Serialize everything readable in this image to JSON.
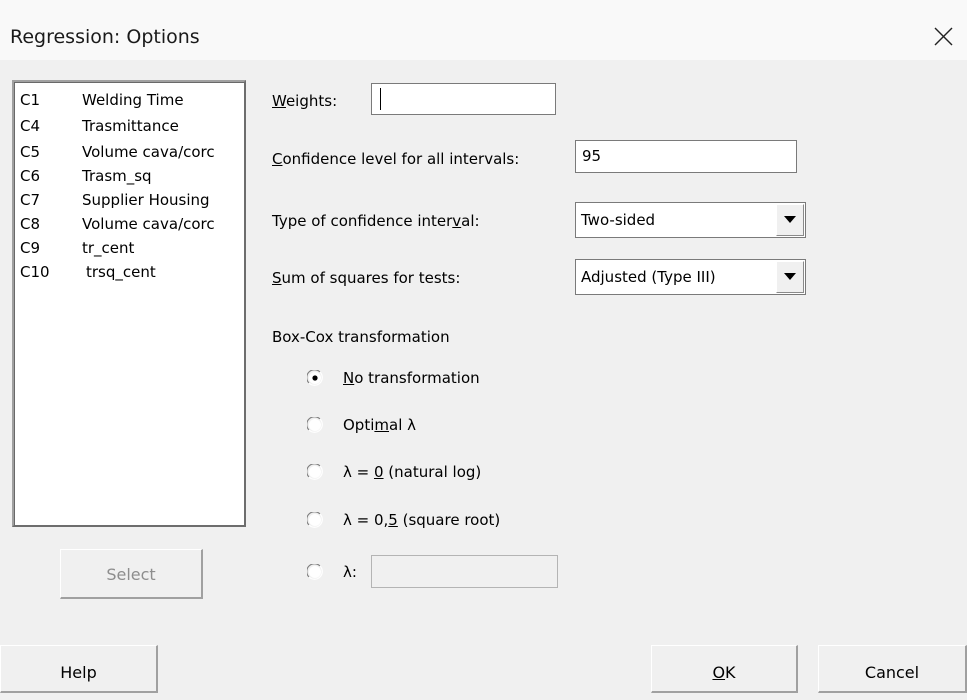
{
  "window": {
    "title": "Regression: Options",
    "close_icon": "close-icon"
  },
  "variables": [
    {
      "col": "C1",
      "name": "Welding Time"
    },
    {
      "col": "C4",
      "name": "Trasmittance"
    },
    {
      "col": "C5",
      "name": "Volume cava/corc"
    },
    {
      "col": "C6",
      "name": "Trasm_sq"
    },
    {
      "col": "C7",
      "name": "Supplier Housing"
    },
    {
      "col": "C8",
      "name": "Volume cava/corc"
    },
    {
      "col": "C9",
      "name": "tr_cent"
    },
    {
      "col": "C10",
      "name": "trsq_cent"
    }
  ],
  "buttons": {
    "select": "Select",
    "help": "Help",
    "ok_prefix": "",
    "ok_accel": "O",
    "ok_rest": "K",
    "cancel": "Cancel"
  },
  "weights": {
    "label_accel": "W",
    "label_rest": "eights:",
    "value": ""
  },
  "confidence": {
    "label_accel": "C",
    "label_rest": "onfidence level for all intervals:",
    "value": "95"
  },
  "interval_type": {
    "label_a": "Type of confidence inter",
    "label_accel": "v",
    "label_b": "al:",
    "selected": "Two-sided"
  },
  "sum_squares": {
    "label_accel": "S",
    "label_rest": "um of squares for tests:",
    "selected": "Adjusted (Type III)"
  },
  "boxcox": {
    "heading": "Box-Cox transformation",
    "options": [
      {
        "pre": "",
        "accel": "N",
        "post": "o transformation",
        "selected": true
      },
      {
        "pre": "Opti",
        "accel": "m",
        "post": "al λ",
        "selected": false
      },
      {
        "pre": "λ = ",
        "accel": "0",
        "post": " (natural log)",
        "selected": false
      },
      {
        "pre": "λ = 0,",
        "accel": "5",
        "post": " (square root)",
        "selected": false
      },
      {
        "pre": "λ:",
        "accel": "",
        "post": "",
        "selected": false
      }
    ],
    "lambda_value": ""
  },
  "colors": {
    "dialog_bg": "#f0f0f0",
    "titlebar_bg": "#f9f9f9",
    "disabled_text": "#8d8d8d"
  }
}
